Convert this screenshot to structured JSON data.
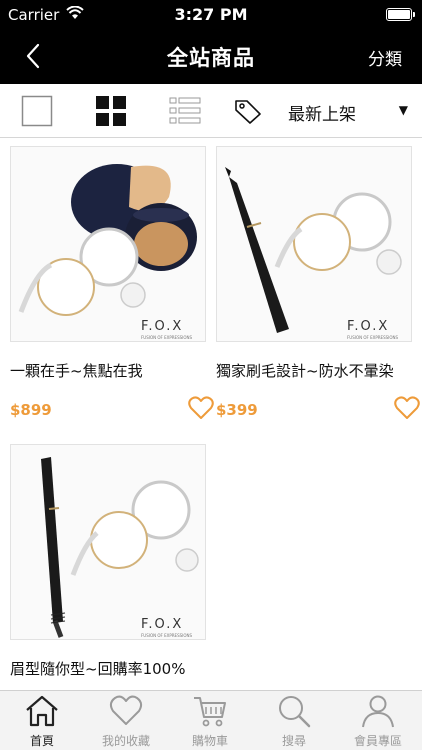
{
  "status_bar": {
    "carrier": "Carrier",
    "time": "3:27 PM"
  },
  "nav": {
    "title": "全站商品",
    "category_label": "分類"
  },
  "toolbar": {
    "sort_label": "最新上架"
  },
  "products": [
    {
      "name": "一顆在手~焦點在我",
      "price": "$899",
      "brand": "F.O.X",
      "tagline": "FUSION OF EXPRESSIONS"
    },
    {
      "name": "獨家刷毛設計~防水不暈染",
      "price": "$399",
      "brand": "F.O.X",
      "tagline": "FUSION OF EXPRESSIONS"
    },
    {
      "name": "眉型隨你型~回購率100%",
      "brand": "F.O.X",
      "tagline": "FUSION OF EXPRESSIONS"
    }
  ],
  "tabs": [
    {
      "label": "首頁",
      "icon": "home-icon"
    },
    {
      "label": "我的收藏",
      "icon": "heart-icon"
    },
    {
      "label": "購物車",
      "icon": "cart-icon"
    },
    {
      "label": "搜尋",
      "icon": "search-icon"
    },
    {
      "label": "會員專區",
      "icon": "member-icon"
    }
  ],
  "colors": {
    "price": "#ee9b3a",
    "bar": "#000000",
    "tab_active": "#222222",
    "tab_inactive": "#9a9a9a"
  }
}
